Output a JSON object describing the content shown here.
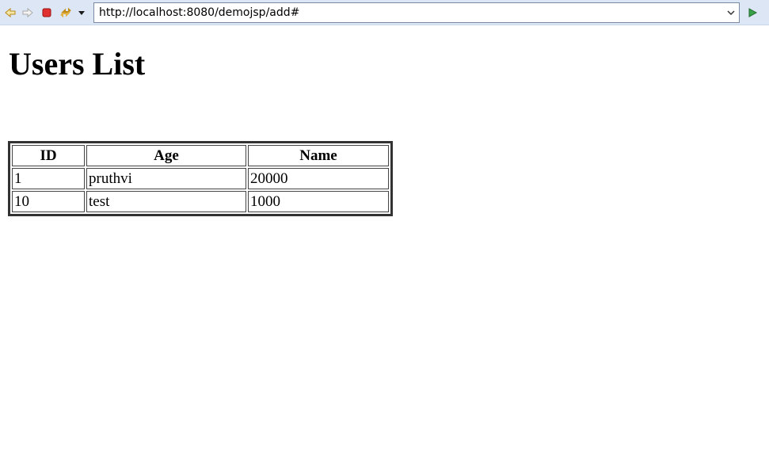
{
  "browser": {
    "url": "http://localhost:8080/demojsp/add#",
    "buttons": {
      "back": "back-arrow-icon",
      "forward": "forward-arrow-icon",
      "stop": "stop-icon",
      "refresh": "refresh-icon",
      "menu": "dropdown-arrow-icon",
      "go": "go-arrow-icon"
    },
    "colors": {
      "toolbar_bg": "#dce6f4",
      "stop_red": "#e03030",
      "go_green": "#3aa04a"
    }
  },
  "page": {
    "title": "Users List",
    "table": {
      "headers": [
        "ID",
        "Age",
        "Name"
      ],
      "rows": [
        [
          "1",
          "pruthvi",
          "20000"
        ],
        [
          "10",
          "test",
          "1000"
        ]
      ]
    }
  }
}
